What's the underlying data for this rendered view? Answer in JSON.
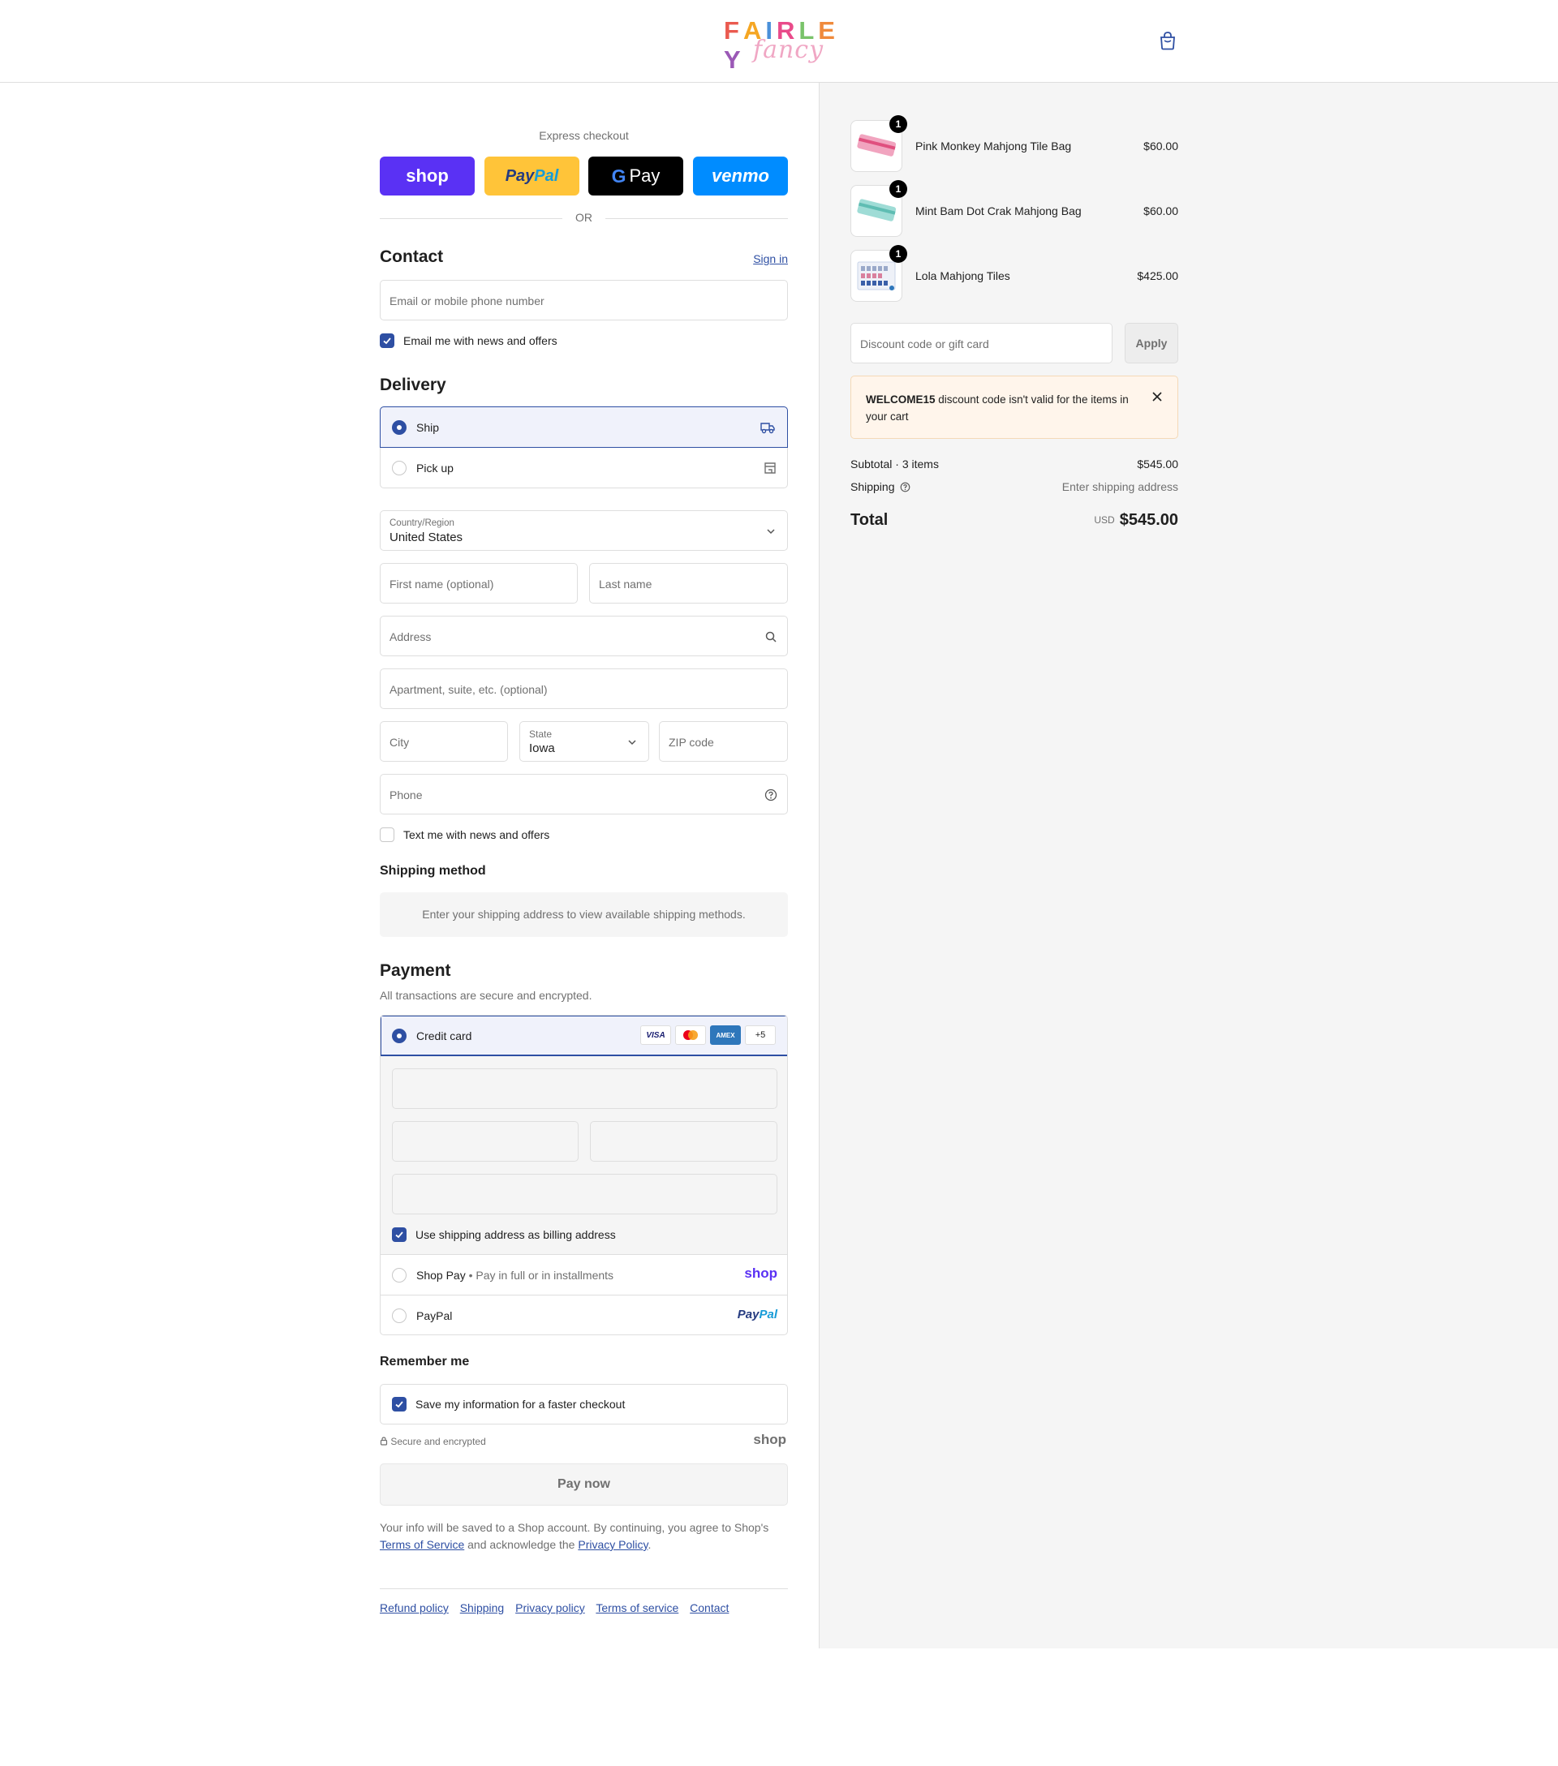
{
  "header": {
    "logo_letters": [
      "F",
      "A",
      "I",
      "R",
      "L",
      "E",
      "Y"
    ],
    "logo_colors": [
      "#ea5a4f",
      "#f5a623",
      "#4a90d9",
      "#e94b8a",
      "#7ac36a",
      "#f08a3c",
      "#9b59b6"
    ],
    "logo_script": "fancy",
    "cart_icon": "shopping-bag-icon"
  },
  "express": {
    "label": "Express checkout",
    "shop": "shop",
    "paypal_a": "Pay",
    "paypal_b": "Pal",
    "gpay_g": "G",
    "gpay": "Pay",
    "venmo": "venmo",
    "or": "OR"
  },
  "contact": {
    "title": "Contact",
    "sign_in": "Sign in",
    "email_placeholder": "Email or mobile phone number",
    "news_label": "Email me with news and offers",
    "news_checked": true
  },
  "delivery": {
    "title": "Delivery",
    "options": [
      {
        "label": "Ship",
        "selected": true,
        "icon": "truck-icon"
      },
      {
        "label": "Pick up",
        "selected": false,
        "icon": "store-icon"
      }
    ],
    "country_label": "Country/Region",
    "country_value": "United States",
    "first_name": "First name (optional)",
    "last_name": "Last name",
    "address": "Address",
    "apartment": "Apartment, suite, etc. (optional)",
    "city": "City",
    "state_label": "State",
    "state_value": "Iowa",
    "zip": "ZIP code",
    "phone": "Phone",
    "text_label": "Text me with news and offers",
    "text_checked": false
  },
  "shipping_method": {
    "title": "Shipping method",
    "note": "Enter your shipping address to view available shipping methods."
  },
  "payment": {
    "title": "Payment",
    "subtitle": "All transactions are secure and encrypted.",
    "credit_card": "Credit card",
    "brands": [
      "VISA",
      "AMEX",
      "+5"
    ],
    "billing_label": "Use shipping address as billing address",
    "shop_pay": "Shop Pay",
    "shop_pay_sub": "Pay in full or in installments",
    "shop_logo": "shop",
    "paypal": "PayPal",
    "paypal_logo_a": "Pay",
    "paypal_logo_b": "Pal"
  },
  "remember": {
    "title": "Remember me",
    "save_label": "Save my information for a faster checkout",
    "secure": "Secure and encrypted",
    "shop_logo": "shop"
  },
  "pay_now": "Pay now",
  "legal": {
    "text1": "Your info will be saved to a Shop account. By continuing, you agree to Shop's",
    "tos": "Terms of Service",
    "text2": "and acknowledge the",
    "privacy": "Privacy Policy",
    "text3": "."
  },
  "footer": [
    "Refund policy",
    "Shipping",
    "Privacy policy",
    "Terms of service",
    "Contact"
  ],
  "cart": {
    "items": [
      {
        "name": "Pink Monkey Mahjong Tile Bag",
        "price": "$60.00",
        "qty": "1",
        "color": "#f1a4bf"
      },
      {
        "name": "Mint Bam Dot Crak Mahjong Bag",
        "price": "$60.00",
        "qty": "1",
        "color": "#9fdcd6"
      },
      {
        "name": "Lola Mahjong Tiles",
        "price": "$425.00",
        "qty": "1",
        "color": "#c9d4e8"
      }
    ],
    "discount_placeholder": "Discount code or gift card",
    "apply": "Apply",
    "warning_code": "WELCOME15",
    "warning_text": " discount code isn't valid for the items in your cart",
    "subtotal_label": "Subtotal · 3 items",
    "subtotal": "$545.00",
    "shipping_label": "Shipping",
    "shipping_value": "Enter shipping address",
    "total_label": "Total",
    "currency": "USD",
    "total": "$545.00"
  }
}
